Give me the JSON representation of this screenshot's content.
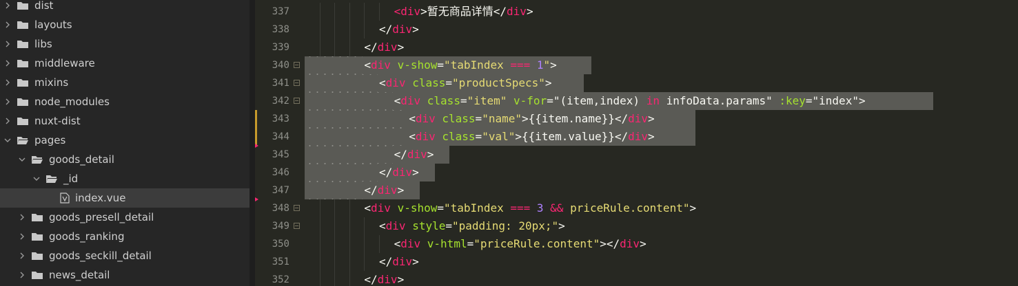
{
  "sidebar": {
    "items": [
      {
        "label": "dist",
        "type": "folder",
        "depth": 0,
        "expanded": false
      },
      {
        "label": "layouts",
        "type": "folder",
        "depth": 0,
        "expanded": false
      },
      {
        "label": "libs",
        "type": "folder",
        "depth": 0,
        "expanded": false
      },
      {
        "label": "middleware",
        "type": "folder",
        "depth": 0,
        "expanded": false
      },
      {
        "label": "mixins",
        "type": "folder",
        "depth": 0,
        "expanded": false
      },
      {
        "label": "node_modules",
        "type": "folder",
        "depth": 0,
        "expanded": false
      },
      {
        "label": "nuxt-dist",
        "type": "folder",
        "depth": 0,
        "expanded": false
      },
      {
        "label": "pages",
        "type": "folder",
        "depth": 0,
        "expanded": true
      },
      {
        "label": "goods_detail",
        "type": "folder",
        "depth": 1,
        "expanded": true
      },
      {
        "label": "_id",
        "type": "folder",
        "depth": 2,
        "expanded": true
      },
      {
        "label": "index.vue",
        "type": "file",
        "depth": 3,
        "selected": true
      },
      {
        "label": "goods_presell_detail",
        "type": "folder",
        "depth": 1,
        "expanded": false
      },
      {
        "label": "goods_ranking",
        "type": "folder",
        "depth": 1,
        "expanded": false
      },
      {
        "label": "goods_seckill_detail",
        "type": "folder",
        "depth": 1,
        "expanded": false
      },
      {
        "label": "news_detail",
        "type": "folder",
        "depth": 1,
        "expanded": false
      }
    ]
  },
  "editor": {
    "lines": [
      {
        "n": "337",
        "indent": 12,
        "fold": false,
        "tokens": [
          [
            "tag",
            "<div"
          ],
          [
            "pl",
            ">暂无商品详情</"
          ],
          [
            "tag",
            "div"
          ],
          [
            "pl",
            ">"
          ]
        ]
      },
      {
        "n": "338",
        "indent": 10,
        "fold": false,
        "tokens": [
          [
            "pl",
            "</"
          ],
          [
            "tag",
            "div"
          ],
          [
            "pl",
            ">"
          ]
        ]
      },
      {
        "n": "339",
        "indent": 8,
        "fold": false,
        "tokens": [
          [
            "pl",
            "</"
          ],
          [
            "tag",
            "div"
          ],
          [
            "pl",
            ">"
          ]
        ]
      },
      {
        "n": "340",
        "indent": 8,
        "fold": true,
        "selected": true,
        "tokens": [
          [
            "pl",
            "<"
          ],
          [
            "tag",
            "div"
          ],
          [
            "pl",
            " "
          ],
          [
            "attr",
            "v-show"
          ],
          [
            "pl",
            "="
          ],
          [
            "str",
            "\"tabIndex "
          ],
          [
            "op",
            "==="
          ],
          [
            "str",
            " "
          ],
          [
            "num",
            "1"
          ],
          [
            "str",
            "\""
          ],
          [
            "pl",
            ">"
          ]
        ]
      },
      {
        "n": "341",
        "indent": 10,
        "fold": true,
        "selected": true,
        "tokens": [
          [
            "pl",
            "<"
          ],
          [
            "tag",
            "div"
          ],
          [
            "pl",
            " "
          ],
          [
            "attr",
            "class"
          ],
          [
            "pl",
            "="
          ],
          [
            "str",
            "\"productSpecs\""
          ],
          [
            "pl",
            ">"
          ]
        ]
      },
      {
        "n": "342",
        "indent": 12,
        "fold": true,
        "selected": true,
        "tokens": [
          [
            "pl",
            "<"
          ],
          [
            "tag",
            "div"
          ],
          [
            "pl",
            " "
          ],
          [
            "attr",
            "class"
          ],
          [
            "pl",
            "="
          ],
          [
            "str",
            "\"item\""
          ],
          [
            "pl",
            " "
          ],
          [
            "attr",
            "v-for"
          ],
          [
            "pl",
            "=\"(item,index) "
          ],
          [
            "op",
            "in"
          ],
          [
            "pl",
            " infoData.params\" "
          ],
          [
            "attr",
            ":key"
          ],
          [
            "pl",
            "=\"index\">"
          ]
        ]
      },
      {
        "n": "343",
        "indent": 14,
        "fold": false,
        "selected": true,
        "tokens": [
          [
            "pl",
            "<"
          ],
          [
            "tag",
            "div"
          ],
          [
            "pl",
            " "
          ],
          [
            "attr",
            "class"
          ],
          [
            "pl",
            "="
          ],
          [
            "str",
            "\"name\""
          ],
          [
            "pl",
            ">{{item.name}}</"
          ],
          [
            "tag",
            "div"
          ],
          [
            "pl",
            ">"
          ]
        ]
      },
      {
        "n": "344",
        "indent": 14,
        "fold": false,
        "selected": true,
        "tokens": [
          [
            "pl",
            "<"
          ],
          [
            "tag",
            "div"
          ],
          [
            "pl",
            " "
          ],
          [
            "attr",
            "class"
          ],
          [
            "pl",
            "="
          ],
          [
            "str",
            "\"val\""
          ],
          [
            "pl",
            ">{{item.value}}</"
          ],
          [
            "tag",
            "div"
          ],
          [
            "pl",
            ">"
          ]
        ]
      },
      {
        "n": "345",
        "indent": 12,
        "fold": false,
        "selected": true,
        "tokens": [
          [
            "pl",
            "</"
          ],
          [
            "tag",
            "div"
          ],
          [
            "pl",
            ">"
          ]
        ]
      },
      {
        "n": "346",
        "indent": 10,
        "fold": false,
        "selected": true,
        "tokens": [
          [
            "pl",
            "</"
          ],
          [
            "tag",
            "div"
          ],
          [
            "pl",
            ">"
          ]
        ]
      },
      {
        "n": "347",
        "indent": 8,
        "fold": false,
        "selected": true,
        "tokens": [
          [
            "pl",
            "</"
          ],
          [
            "tag",
            "div"
          ],
          [
            "pl",
            ">"
          ]
        ]
      },
      {
        "n": "348",
        "indent": 8,
        "fold": true,
        "tokens": [
          [
            "pl",
            "<"
          ],
          [
            "tag",
            "div"
          ],
          [
            "pl",
            " "
          ],
          [
            "attr",
            "v-show"
          ],
          [
            "pl",
            "="
          ],
          [
            "str",
            "\"tabIndex "
          ],
          [
            "op",
            "==="
          ],
          [
            "str",
            " "
          ],
          [
            "num",
            "3"
          ],
          [
            "str",
            " "
          ],
          [
            "op",
            "&&"
          ],
          [
            "str",
            " priceRule.content\""
          ],
          [
            "pl",
            ">"
          ]
        ]
      },
      {
        "n": "349",
        "indent": 10,
        "fold": true,
        "tokens": [
          [
            "pl",
            "<"
          ],
          [
            "tag",
            "div"
          ],
          [
            "pl",
            " "
          ],
          [
            "attr",
            "style"
          ],
          [
            "pl",
            "="
          ],
          [
            "str",
            "\"padding: 20px;\""
          ],
          [
            "pl",
            ">"
          ]
        ]
      },
      {
        "n": "350",
        "indent": 12,
        "fold": false,
        "tokens": [
          [
            "pl",
            "<"
          ],
          [
            "tag",
            "div"
          ],
          [
            "pl",
            " "
          ],
          [
            "attr",
            "v-html"
          ],
          [
            "pl",
            "="
          ],
          [
            "str",
            "\"priceRule.content\""
          ],
          [
            "pl",
            "></"
          ],
          [
            "tag",
            "div"
          ],
          [
            "pl",
            ">"
          ]
        ]
      },
      {
        "n": "351",
        "indent": 10,
        "fold": false,
        "tokens": [
          [
            "pl",
            "</"
          ],
          [
            "tag",
            "div"
          ],
          [
            "pl",
            ">"
          ]
        ]
      },
      {
        "n": "352",
        "indent": 8,
        "fold": false,
        "tokens": [
          [
            "pl",
            "</"
          ],
          [
            "tag",
            "div"
          ],
          [
            "pl",
            ">"
          ]
        ]
      }
    ]
  },
  "icons": {
    "folder": "folder-icon",
    "folder_open": "folder-open-icon",
    "file": "vue-file-icon",
    "chevron_right": "chevron-right-icon",
    "chevron_down": "chevron-down-icon"
  },
  "colors": {
    "sidebar_bg": "#262626",
    "editor_bg": "#272822",
    "selection": "#5a5a55",
    "tag": "#f92672",
    "attr": "#a6e22e",
    "string": "#e6db74",
    "number": "#ae81ff",
    "modified_marker": "#c79a2c"
  }
}
